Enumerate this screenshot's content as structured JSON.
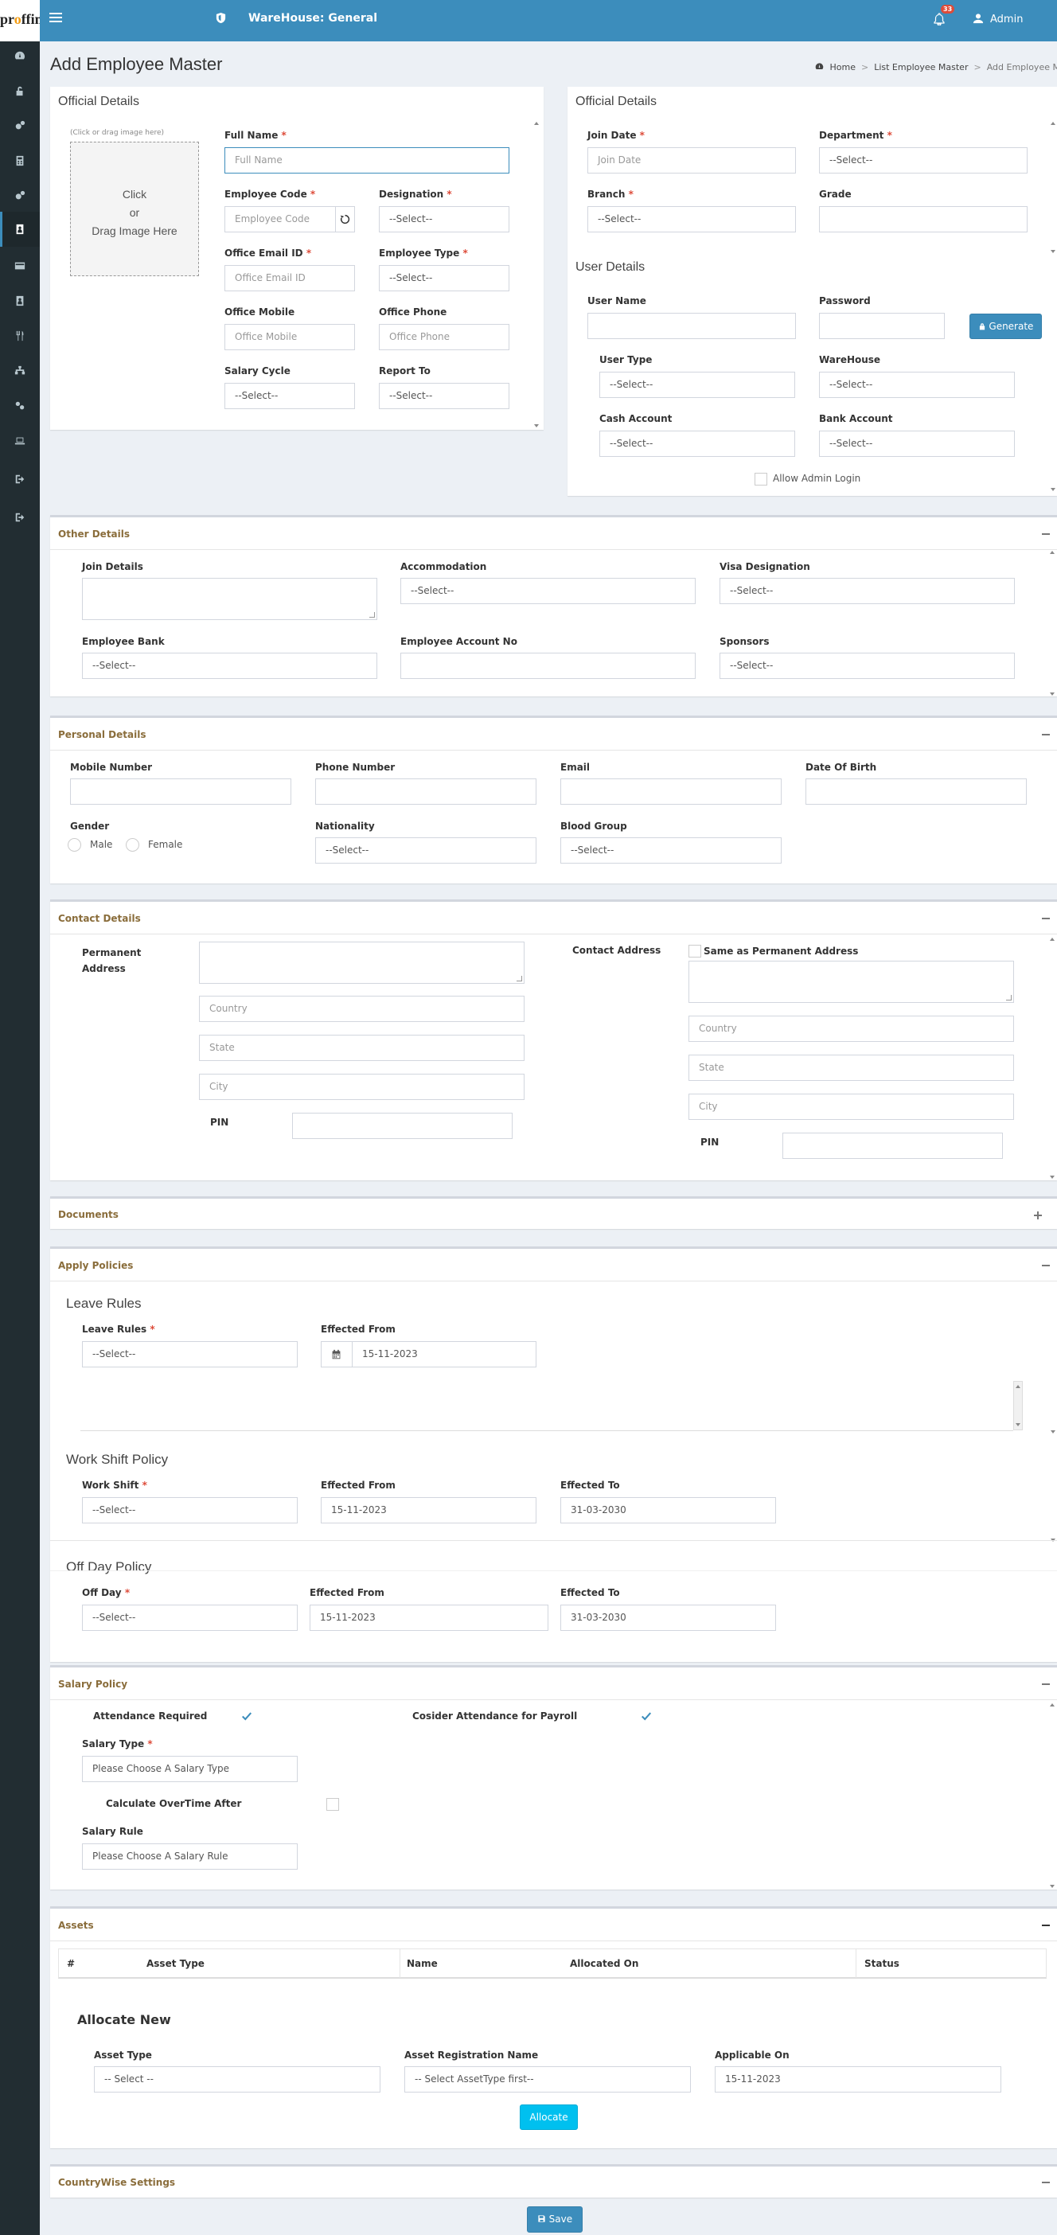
{
  "brand": {
    "logo_text_pre": "pr",
    "logo_text_o": "o",
    "logo_text_post": "ffin"
  },
  "topbar": {
    "warehouse_title": "WareHouse: General",
    "notification_count": "33",
    "user_name": "Admin"
  },
  "sidebar": {
    "icons": [
      "dashboard-icon",
      "unlock-icon",
      "cogs-icon",
      "calculator-icon",
      "cogs-icon",
      "id-card-icon",
      "credit-card-icon",
      "id-badge-icon",
      "cutlery-icon",
      "sitemap-icon",
      "users-cog-icon",
      "laptop-icon",
      "sign-out-icon",
      "sign-out-icon"
    ],
    "active_index": 5
  },
  "page": {
    "title": "Add Employee Master"
  },
  "breadcrumb": {
    "home": "Home",
    "list": "List Employee Master",
    "current": "Add Employee Master"
  },
  "official_left": {
    "title": "Official Details",
    "image_hint": "(Click or drag image here)",
    "image_text_1": "Click",
    "image_text_2": "or",
    "image_text_3": "Drag Image Here",
    "full_name_label": "Full Name",
    "full_name_placeholder": "Full Name",
    "employee_code_label": "Employee Code",
    "employee_code_placeholder": "Employee Code",
    "designation_label": "Designation",
    "designation_value": "--Select--",
    "office_email_label": "Office Email ID",
    "office_email_placeholder": "Office Email ID",
    "employee_type_label": "Employee Type",
    "employee_type_value": "--Select--",
    "office_mobile_label": "Office Mobile",
    "office_mobile_placeholder": "Office Mobile",
    "office_phone_label": "Office Phone",
    "office_phone_placeholder": "Office Phone",
    "salary_cycle_label": "Salary Cycle",
    "salary_cycle_value": "--Select--",
    "report_to_label": "Report To",
    "report_to_value": "--Select--"
  },
  "official_right": {
    "title": "Official Details",
    "join_date_label": "Join Date",
    "join_date_placeholder": "Join Date",
    "department_label": "Department",
    "department_value": "--Select--",
    "branch_label": "Branch",
    "branch_value": "--Select--",
    "grade_label": "Grade",
    "grade_value": "",
    "user_details_title": "User Details",
    "user_name_label": "User Name",
    "password_label": "Password",
    "generate_button": "Generate",
    "user_type_label": "User Type",
    "user_type_value": "--Select--",
    "warehouse_label": "WareHouse",
    "warehouse_value": "--Select--",
    "cash_account_label": "Cash Account",
    "cash_account_value": "--Select--",
    "bank_account_label": "Bank Account",
    "bank_account_value": "--Select--",
    "allow_admin_label": "Allow Admin Login"
  },
  "other_details": {
    "title": "Other Details",
    "join_details_label": "Join Details",
    "accommodation_label": "Accommodation",
    "accommodation_value": "--Select--",
    "visa_label": "Visa Designation",
    "visa_value": "--Select--",
    "employee_bank_label": "Employee Bank",
    "employee_bank_value": "--Select--",
    "account_no_label": "Employee Account No",
    "sponsors_label": "Sponsors",
    "sponsors_value": "--Select--"
  },
  "personal_details": {
    "title": "Personal Details",
    "mobile_label": "Mobile Number",
    "phone_label": "Phone Number",
    "email_label": "Email",
    "dob_label": "Date Of Birth",
    "gender_label": "Gender",
    "male_label": "Male",
    "female_label": "Female",
    "nationality_label": "Nationality",
    "nationality_value": "--Select--",
    "blood_group_label": "Blood Group",
    "blood_group_value": "--Select--"
  },
  "contact_details": {
    "title": "Contact Details",
    "permanent_label_1": "Permanent",
    "permanent_label_2": "Address",
    "country_placeholder": "Country",
    "state_placeholder": "State",
    "city_placeholder": "City",
    "pin_label": "PIN",
    "contact_address_label": "Contact Address",
    "same_as_label": "Same as Permanent Address"
  },
  "documents": {
    "title": "Documents"
  },
  "apply_policies": {
    "title": "Apply Policies",
    "leave_rules_title": "Leave Rules",
    "leave_rules_label": "Leave Rules",
    "leave_rules_value": "--Select--",
    "leave_effected_from_label": "Effected From",
    "leave_effected_from_value": "15-11-2023",
    "work_shift_title": "Work Shift Policy",
    "work_shift_label": "Work Shift",
    "work_shift_value": "--Select--",
    "ws_effected_from_label": "Effected From",
    "ws_effected_from_value": "15-11-2023",
    "ws_effected_to_label": "Effected To",
    "ws_effected_to_value": "31-03-2030",
    "off_day_title": "Off Day Policy",
    "off_day_label": "Off Day",
    "off_day_value": "--Select--",
    "od_effected_from_label": "Effected From",
    "od_effected_from_value": "15-11-2023",
    "od_effected_to_label": "Effected To",
    "od_effected_to_value": "31-03-2030"
  },
  "salary_policy": {
    "title": "Salary Policy",
    "attendance_required_label": "Attendance Required",
    "attendance_required_checked": true,
    "consider_attendance_label": "Cosider Attendance for Payroll",
    "consider_attendance_checked": true,
    "salary_type_label": "Salary Type",
    "salary_type_value": "Please Choose A Salary Type",
    "overtime_label": "Calculate OverTime After",
    "overtime_checked": false,
    "salary_rule_label": "Salary Rule",
    "salary_rule_value": "Please Choose A Salary Rule"
  },
  "assets": {
    "title": "Assets",
    "columns": [
      "#",
      "Asset Type",
      "Name",
      "Allocated On",
      "Status"
    ],
    "allocate_title": "Allocate New",
    "asset_type_label": "Asset Type",
    "asset_type_value": "-- Select --",
    "asset_reg_label": "Asset Registration Name",
    "asset_reg_value": "-- Select AssetType first--",
    "applicable_on_label": "Applicable On",
    "applicable_on_value": "15-11-2023",
    "allocate_button": "Allocate"
  },
  "countrywise": {
    "title": "CountryWise Settings"
  },
  "footer": {
    "save_button": "Save"
  },
  "colors": {
    "primary": "#3c8dbc",
    "sidebar": "#222d32",
    "section_title": "#8a6d3b",
    "required": "#dd4b39",
    "info": "#00c0ef"
  }
}
